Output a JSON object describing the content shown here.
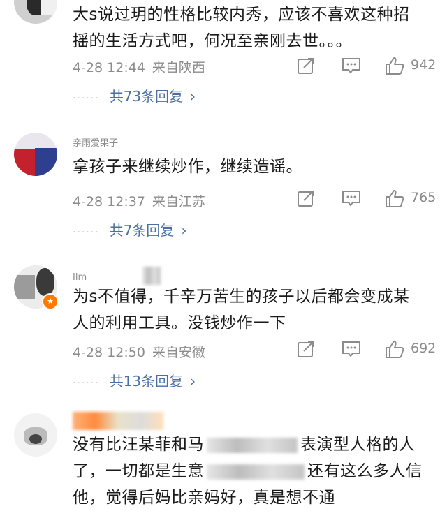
{
  "comments": [
    {
      "text_lines": [
        "大s说过玥的性格比较内秀，应该不喜欢这种招",
        "摇的生活方式吧，何况至亲刚去世。。。"
      ],
      "time": "4-28 12:44",
      "location": "来自陕西",
      "likes": "942",
      "replies": "共73条回复"
    },
    {
      "username": "亲雨爱果子",
      "text_lines": [
        "拿孩子来继续炒作，继续造谣。"
      ],
      "time": "4-28 12:37",
      "location": "来自江苏",
      "likes": "765",
      "replies": "共7条回复"
    },
    {
      "username": "Ilm",
      "text_lines": [
        "为s不值得，千辛万苦生的孩子以后都会变成某",
        "人的利用工具。没钱炒作一下"
      ],
      "time": "4-28 12:50",
      "location": "来自安徽",
      "likes": "692",
      "replies": "共13条回复"
    },
    {
      "text_lines": [
        "没有比汪某菲和马",
        "表演型人格的人",
        "了，一切都是生意",
        "还有这么多人信",
        "他，觉得后妈比亲妈好，真是想不通"
      ]
    }
  ],
  "icons": {
    "share": "share-icon",
    "comment": "comment-icon",
    "like": "thumbs-up-icon",
    "chevron": "chevron-right-icon",
    "vip": "vip-badge-icon"
  },
  "colors": {
    "link": "#4a6fa5",
    "meta": "#8c8c8c",
    "text": "#1a1a1a",
    "badge": "#ff7a00"
  }
}
